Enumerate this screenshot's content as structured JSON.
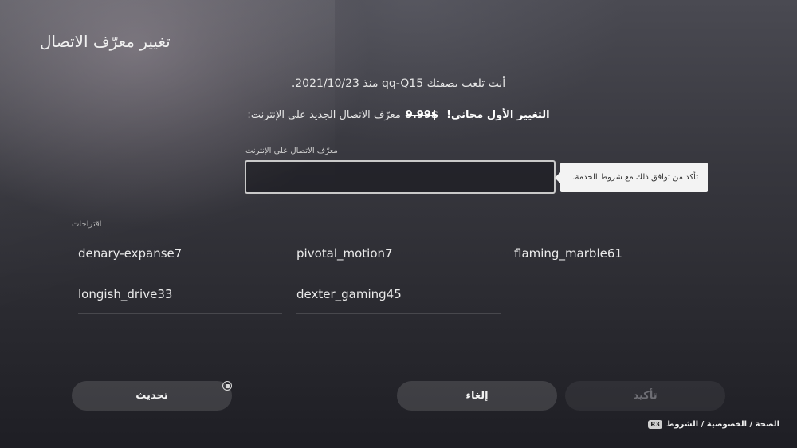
{
  "title": "تغيير معرّف الاتصال",
  "info_line": "أنت تلعب بصفتك qq-Q15 منذ 2021/10/23.",
  "offer": {
    "free_text": "التغيير الأول مجاني!",
    "old_price": "$9.99",
    "rest": "معرّف الاتصال الجديد على الإنترنت:"
  },
  "input": {
    "label": "معرّف الاتصال على الإنترنت",
    "value": "",
    "placeholder": ""
  },
  "tooltip": "تأكد من توافق ذلك مع شروط الخدمة.",
  "suggestions": {
    "header": "اقتراحات",
    "items": [
      "denary-expanse7",
      "pivotal_motion7",
      "flaming_marble61",
      "longish_drive33",
      "dexter_gaming45"
    ]
  },
  "buttons": {
    "refresh": "تحديث",
    "cancel": "إلغاء",
    "confirm": "تأكيد"
  },
  "footer": {
    "r3": "R3",
    "text": "الصحة / الخصوصية / الشروط"
  },
  "icons": {
    "refresh": "square-button-icon"
  }
}
